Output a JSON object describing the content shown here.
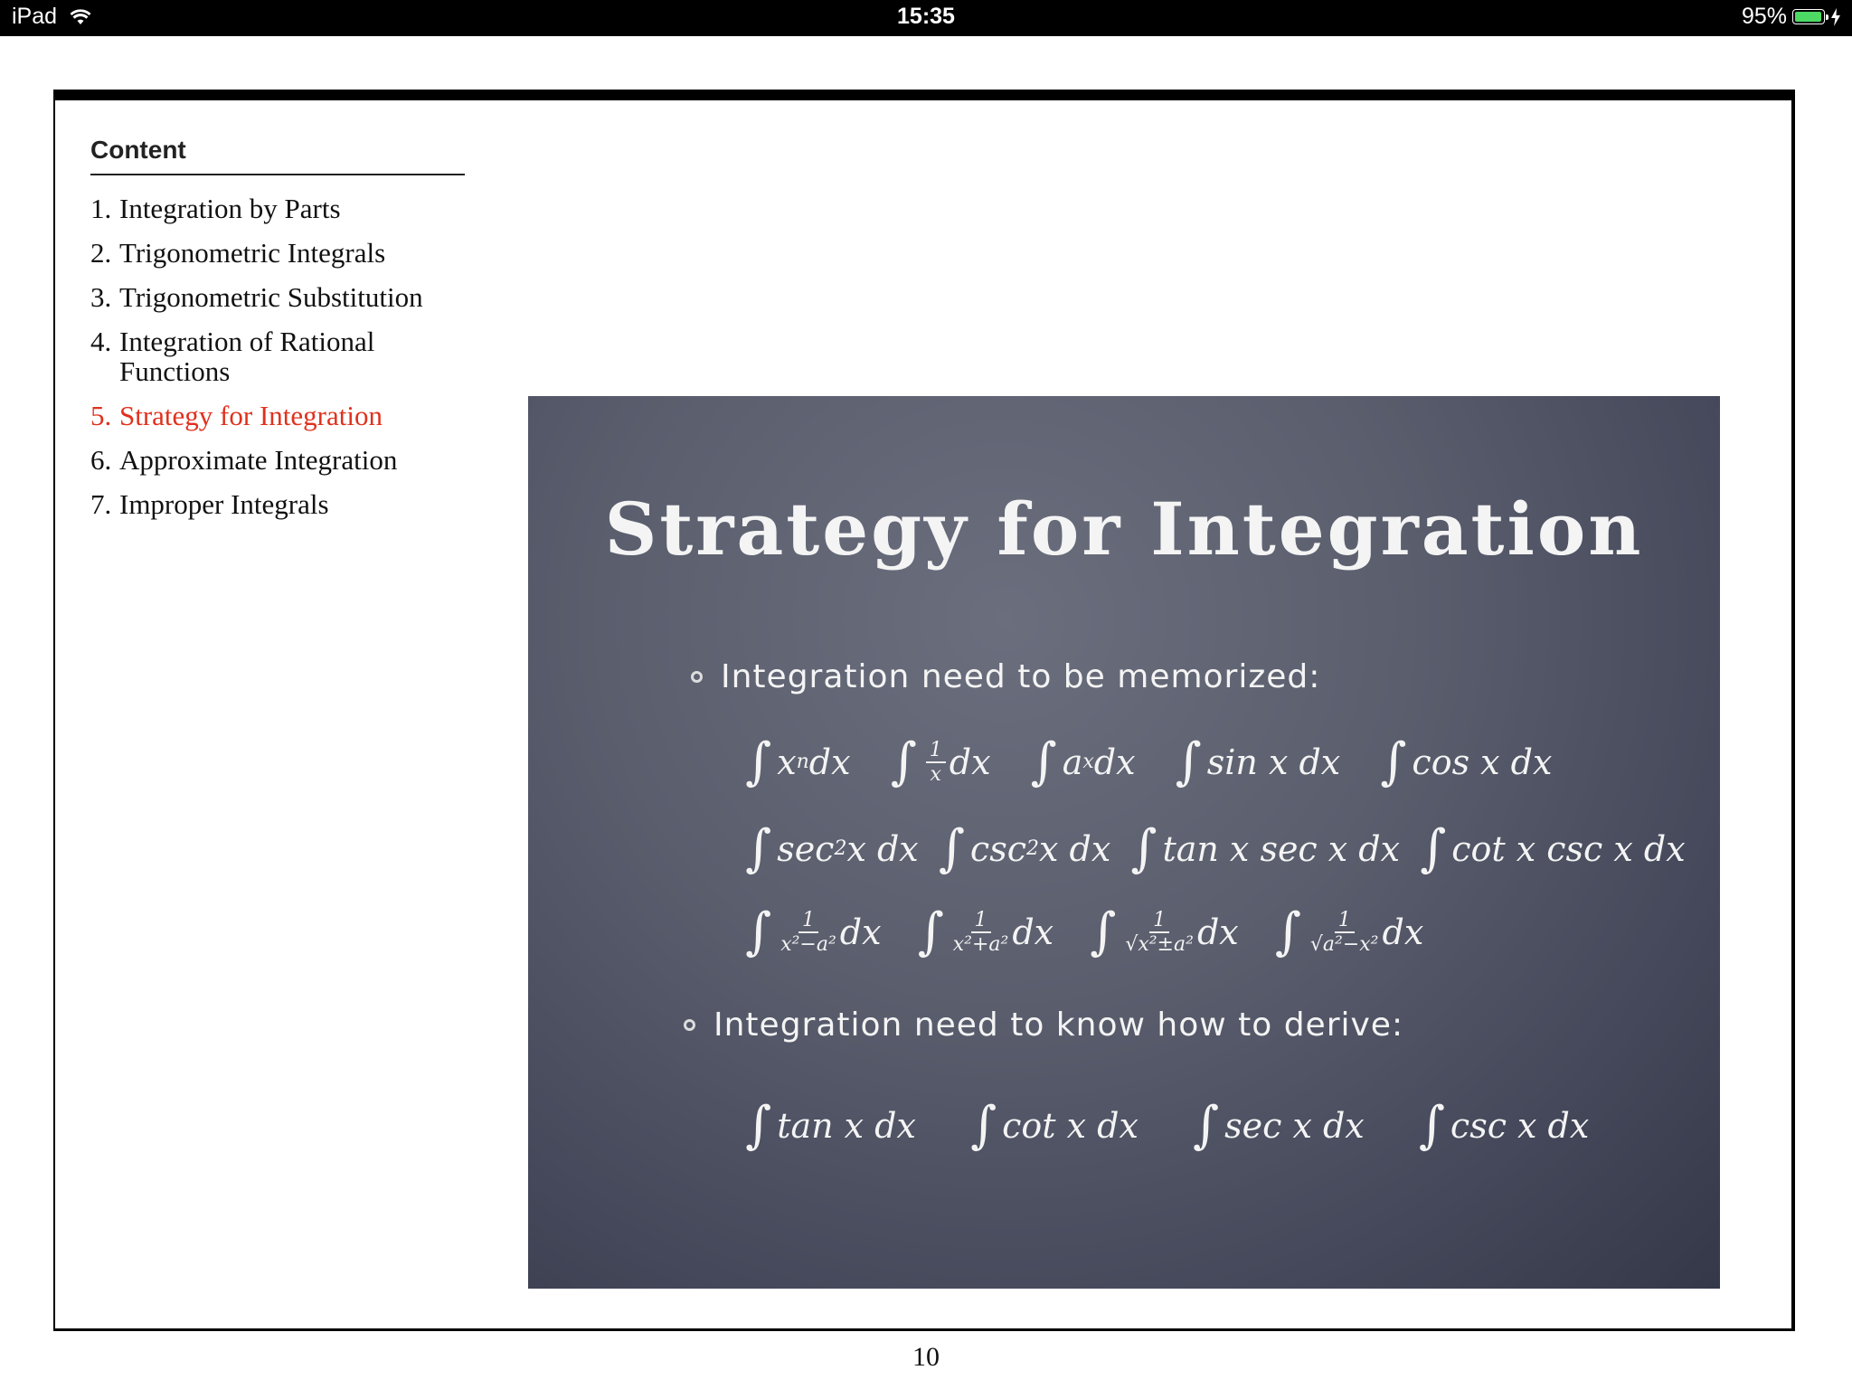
{
  "status_bar": {
    "device": "iPad",
    "time": "15:35",
    "battery_percent": "95%",
    "battery_level": 0.95,
    "colors": {
      "battery_fill": "#4cd964"
    }
  },
  "toc": {
    "title": "Content",
    "items": [
      {
        "num": "1.",
        "label": "Integration by Parts",
        "active": false
      },
      {
        "num": "2.",
        "label": "Trigonometric Integrals",
        "active": false
      },
      {
        "num": "3.",
        "label": "Trigonometric Substitution",
        "active": false
      },
      {
        "num": "4.",
        "label": "Integration of Rational Functions",
        "active": false
      },
      {
        "num": "5.",
        "label": "Strategy for Integration",
        "active": true
      },
      {
        "num": "6.",
        "label": "Approximate Integration",
        "active": false
      },
      {
        "num": "7.",
        "label": "Improper Integrals",
        "active": false
      }
    ],
    "active_color": "#e0311d"
  },
  "slide": {
    "title": "Strategy for Integration",
    "bullet1": "Integration need to be memorized:",
    "row1": [
      "x^n dx",
      "1/x dx",
      "a^x dx",
      "sin x dx",
      "cos x dx"
    ],
    "row2": [
      "sec^2 x dx",
      "csc^2 x dx",
      "tan x sec x dx",
      "cot x csc x dx"
    ],
    "row3": [
      "1/(x^2 - a^2) dx",
      "1/(x^2 + a^2) dx",
      "1/sqrt(x^2 ± a^2) dx",
      "1/sqrt(a^2 - x^2) dx"
    ],
    "bullet2": "Integration need to know how to derive:",
    "row4": [
      "tan x dx",
      "cot x dx",
      "sec x dx",
      "csc x dx"
    ]
  },
  "page_number": "10"
}
